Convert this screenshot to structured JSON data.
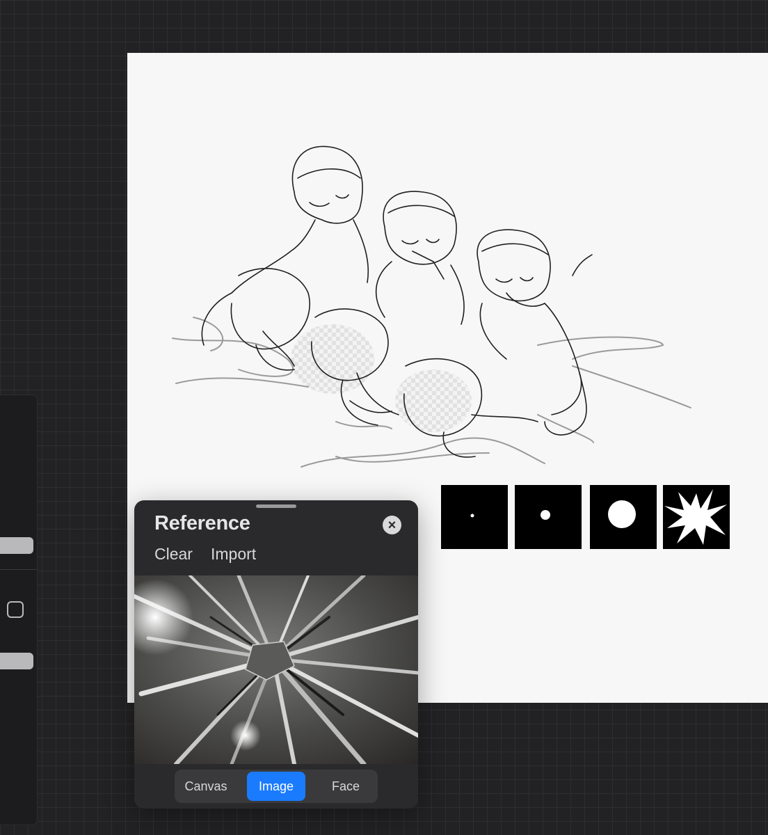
{
  "reference_panel": {
    "title": "Reference",
    "actions": {
      "clear": "Clear",
      "import": "Import"
    },
    "close_icon": "close-icon",
    "modes": [
      {
        "label": "Canvas",
        "selected": false
      },
      {
        "label": "Image",
        "selected": true
      },
      {
        "label": "Face",
        "selected": false
      }
    ]
  },
  "brush_previews": [
    {
      "icon": "tiny-dot-brush-icon"
    },
    {
      "icon": "small-dot-brush-icon"
    },
    {
      "icon": "circle-brush-icon"
    },
    {
      "icon": "splatter-brush-icon"
    }
  ],
  "colors": {
    "accent": "#1a7bff",
    "panel_bg": "#2a2a2c",
    "app_bg": "#222224",
    "canvas_bg": "#f7f7f7"
  }
}
